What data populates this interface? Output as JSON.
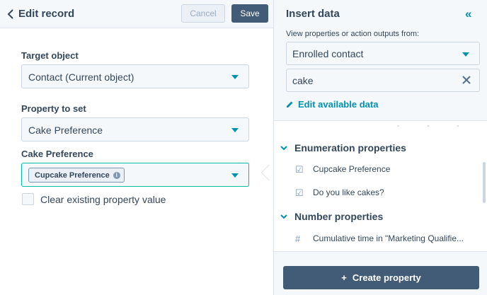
{
  "header": {
    "title": "Edit record",
    "cancel_label": "Cancel",
    "save_label": "Save"
  },
  "form": {
    "target_object": {
      "label": "Target object",
      "value": "Contact (Current object)"
    },
    "property_to_set": {
      "label": "Property to set",
      "value": "Cake Preference"
    },
    "cake_preference": {
      "label": "Cake Preference",
      "token": "Cupcake Preference"
    },
    "clear_checkbox": {
      "label": "Clear existing property value",
      "checked": false
    }
  },
  "insert_panel": {
    "title": "Insert data",
    "view_label": "View properties or action outputs from:",
    "source_value": "Enrolled contact",
    "search_value": "cake",
    "edit_link": "Edit available data",
    "groups": [
      {
        "name": "Enumeration properties",
        "items": [
          "Cupcake Preference",
          "Do you like cakes?"
        ]
      },
      {
        "name": "Number properties",
        "items": [
          "Cumulative time in \"Marketing Qualifie..."
        ]
      }
    ],
    "create_label": "Create property"
  },
  "colors": {
    "primary_dark": "#425b76",
    "accent_teal": "#0091ae",
    "focus_green": "#00bda5",
    "text": "#33475b"
  }
}
